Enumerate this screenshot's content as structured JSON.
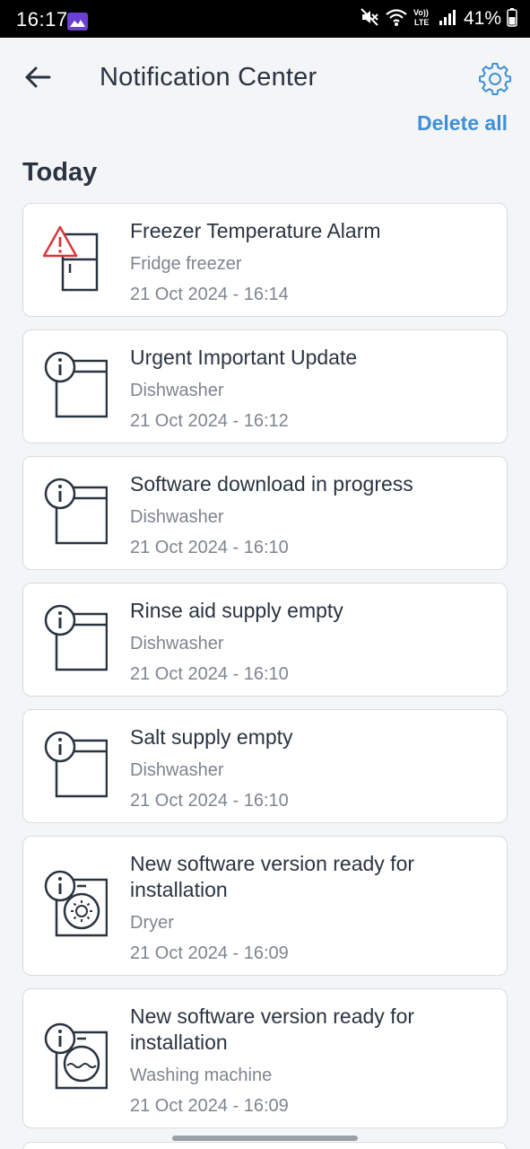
{
  "status_bar": {
    "time": "16:17",
    "battery_text": "41%",
    "icons": [
      "gallery-app-icon",
      "mute-icon",
      "wifi-icon",
      "volte-icon",
      "signal-icon",
      "battery-icon"
    ]
  },
  "header": {
    "title": "Notification Center",
    "back_icon": "arrow-left-icon",
    "settings_icon": "gear-icon"
  },
  "actions": {
    "delete_all": "Delete all"
  },
  "section": {
    "heading": "Today"
  },
  "notifications": [
    {
      "title": "Freezer Temperature Alarm",
      "device": "Fridge freezer",
      "timestamp": "21 Oct 2024 - 16:14",
      "icon": "fridge-warning-icon"
    },
    {
      "title": "Urgent Important Update",
      "device": "Dishwasher",
      "timestamp": "21 Oct 2024 - 16:12",
      "icon": "dishwasher-info-icon"
    },
    {
      "title": "Software download in progress",
      "device": "Dishwasher",
      "timestamp": "21 Oct 2024 - 16:10",
      "icon": "dishwasher-info-icon"
    },
    {
      "title": "Rinse aid supply empty",
      "device": "Dishwasher",
      "timestamp": "21 Oct 2024 - 16:10",
      "icon": "dishwasher-info-icon"
    },
    {
      "title": "Salt supply empty",
      "device": "Dishwasher",
      "timestamp": "21 Oct 2024 - 16:10",
      "icon": "dishwasher-info-icon"
    },
    {
      "title": "New software version ready for installation",
      "device": "Dryer",
      "timestamp": "21 Oct 2024 - 16:09",
      "icon": "dryer-info-icon"
    },
    {
      "title": "New software version ready for installation",
      "device": "Washing machine",
      "timestamp": "21 Oct 2024 - 16:09",
      "icon": "washer-info-icon"
    }
  ],
  "colors": {
    "accent": "#3f8fd8",
    "warning": "#d9363e",
    "text": "#2a3441",
    "muted": "#7d858f",
    "background": "#f4f5f7"
  }
}
